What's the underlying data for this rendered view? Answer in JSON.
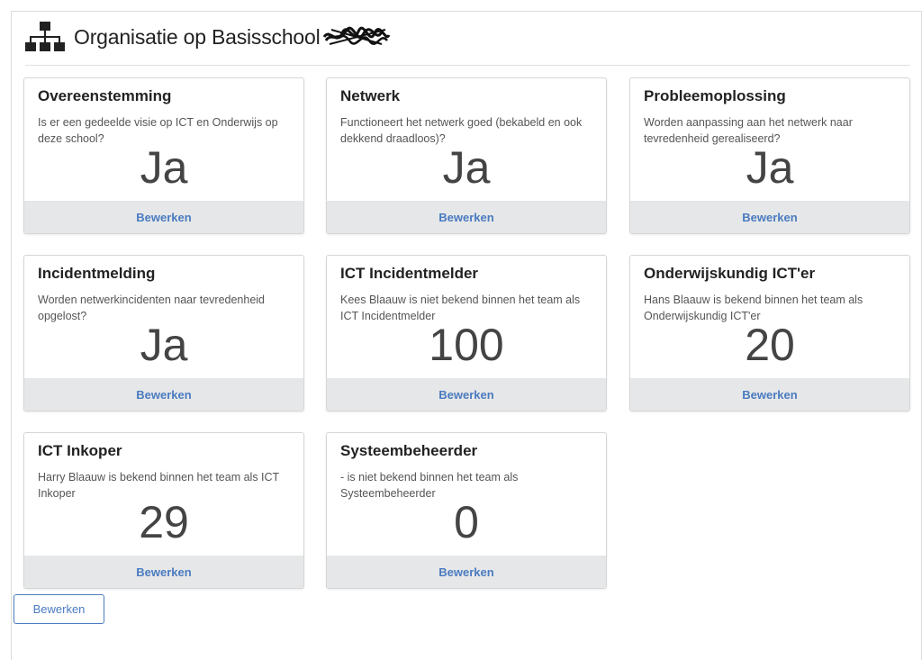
{
  "header": {
    "title": "Organisatie op Basisschool",
    "icon": "sitemap-icon"
  },
  "cards": [
    {
      "title": "Overeenstemming",
      "description": "Is er een gedeelde visie op ICT en Onderwijs op deze school?",
      "value": "Ja",
      "action": "Bewerken"
    },
    {
      "title": "Netwerk",
      "description": "Functioneert het netwerk goed (bekabeld en ook dekkend draadloos)?",
      "value": "Ja",
      "action": "Bewerken"
    },
    {
      "title": "Probleemoplossing",
      "description": "Worden aanpassing aan het netwerk naar tevredenheid gerealiseerd?",
      "value": "Ja",
      "action": "Bewerken"
    },
    {
      "title": "Incidentmelding",
      "description": "Worden netwerkincidenten naar tevredenheid opgelost?",
      "value": "Ja",
      "action": "Bewerken"
    },
    {
      "title": "ICT Incidentmelder",
      "description": "Kees Blaauw is niet bekend binnen het team als ICT Incidentmelder",
      "value": "100",
      "action": "Bewerken"
    },
    {
      "title": "Onderwijskundig ICT'er",
      "description": "Hans Blaauw is bekend binnen het team als Onderwijskundig ICT'er",
      "value": "20",
      "action": "Bewerken"
    },
    {
      "title": "ICT Inkoper",
      "description": "Harry Blaauw is bekend binnen het team als ICT Inkoper",
      "value": "29",
      "action": "Bewerken"
    },
    {
      "title": "Systeembeheerder",
      "description": "- is niet bekend binnen het team als Systeembeheerder",
      "value": "0",
      "action": "Bewerken"
    }
  ],
  "footer": {
    "edit_button": "Bewerken"
  },
  "colors": {
    "accent": "#4a7bc0",
    "card_footer_bg": "#e6e7e8"
  }
}
